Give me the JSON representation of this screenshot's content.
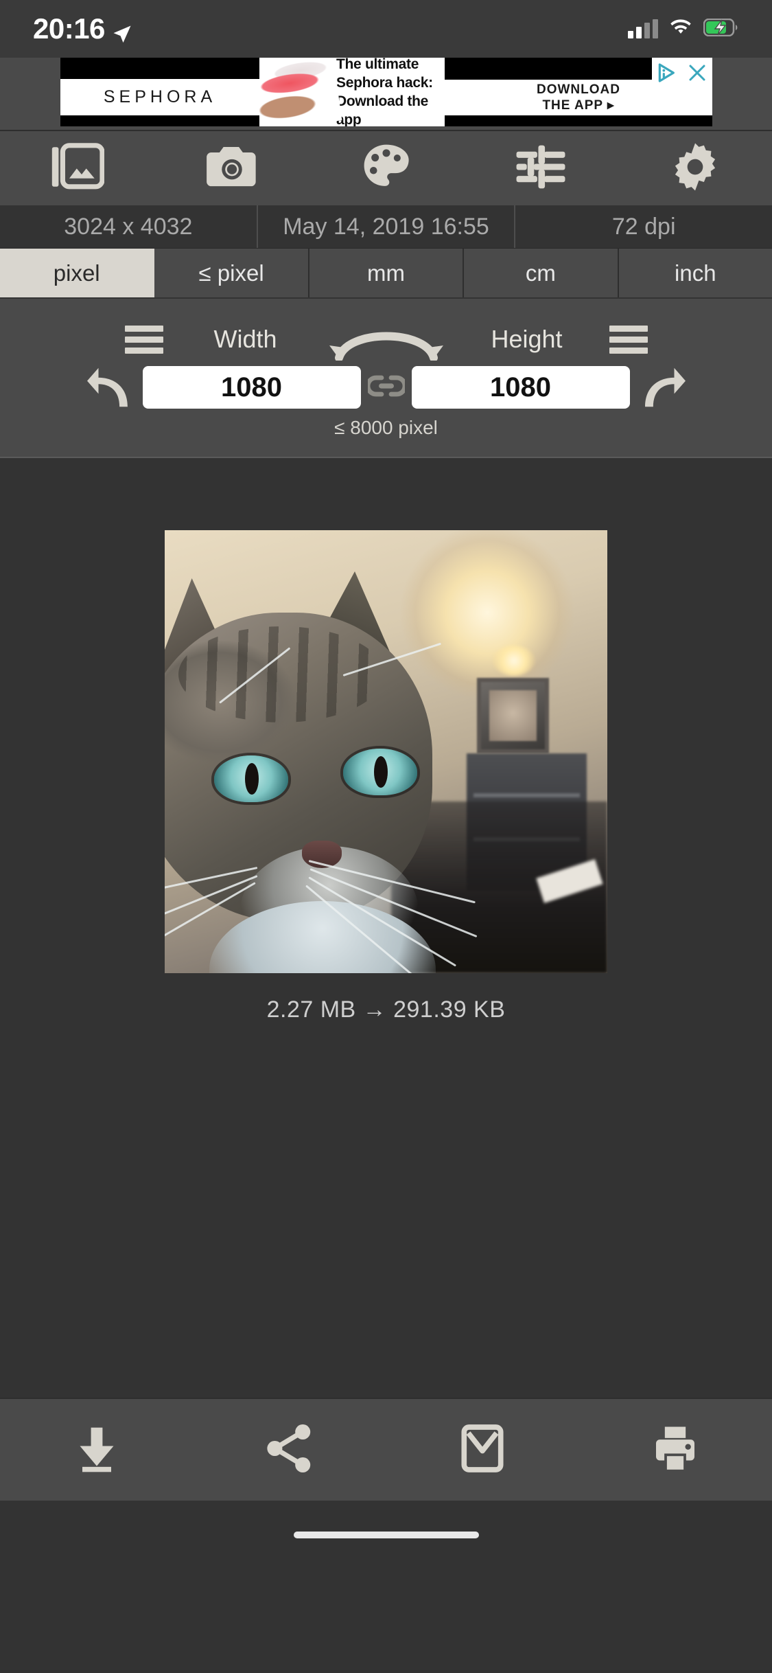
{
  "status_bar": {
    "time": "20:16",
    "location_icon": "location-arrow-icon",
    "signal_icon": "cellular-signal-icon",
    "wifi_icon": "wifi-icon",
    "battery_icon": "battery-charging-icon"
  },
  "ad": {
    "brand": "SEPHORA",
    "headline_line1": "The ultimate",
    "headline_line2": "Sephora hack:",
    "headline_line3": "Download the app",
    "cta_line1": "DOWNLOAD",
    "cta_line2": "THE APP ▸",
    "adchoices_icon": "adchoices-icon",
    "close_icon": "close-icon"
  },
  "toolbar": {
    "items": [
      {
        "name": "gallery",
        "label": "Gallery",
        "icon": "gallery-icon"
      },
      {
        "name": "camera",
        "label": "Camera",
        "icon": "camera-icon"
      },
      {
        "name": "palette",
        "label": "Palette",
        "icon": "palette-icon"
      },
      {
        "name": "adjust",
        "label": "Adjust",
        "icon": "sliders-icon"
      },
      {
        "name": "settings",
        "label": "Settings",
        "icon": "gear-icon"
      }
    ]
  },
  "meta": {
    "dimensions": "3024 x 4032",
    "date": "May 14, 2019 16:55",
    "dpi": "72 dpi"
  },
  "unit_tabs": {
    "selected": "pixel",
    "items": [
      "pixel",
      "≤ pixel",
      "mm",
      "cm",
      "inch"
    ]
  },
  "size_panel": {
    "width_label": "Width",
    "height_label": "Height",
    "width_value": "1080",
    "height_value": "1080",
    "width_placeholder": "Width",
    "height_placeholder": "Height",
    "limit_note": "≤ 8000 pixel",
    "undo_icon": "undo-icon",
    "redo_icon": "redo-icon",
    "swap_icon": "swap-arrows-icon",
    "link_icon": "link-aspect-ratio-icon",
    "width_menu_icon": "hamburger-menu-icon",
    "height_menu_icon": "hamburger-menu-icon"
  },
  "preview": {
    "image_alt": "Tabby cat photo preview",
    "original_size": "2.27 MB",
    "arrow": "→",
    "new_size": "291.39 KB",
    "filesize_text": "2.27 MB  →  291.39 KB"
  },
  "bottom_bar": {
    "items": [
      {
        "name": "save",
        "label": "Save",
        "icon": "download-icon"
      },
      {
        "name": "share",
        "label": "Share",
        "icon": "share-icon"
      },
      {
        "name": "email",
        "label": "Email",
        "icon": "mail-icon"
      },
      {
        "name": "print",
        "label": "Print",
        "icon": "print-icon"
      }
    ]
  },
  "colors": {
    "app_bg": "#333333",
    "panel_bg": "#4a4a4a",
    "icon_tint": "#d8d5cd",
    "active_tab_bg": "#d9d6cf",
    "ad_accent": "#3aa7bd",
    "status_text": "#ffffff"
  }
}
